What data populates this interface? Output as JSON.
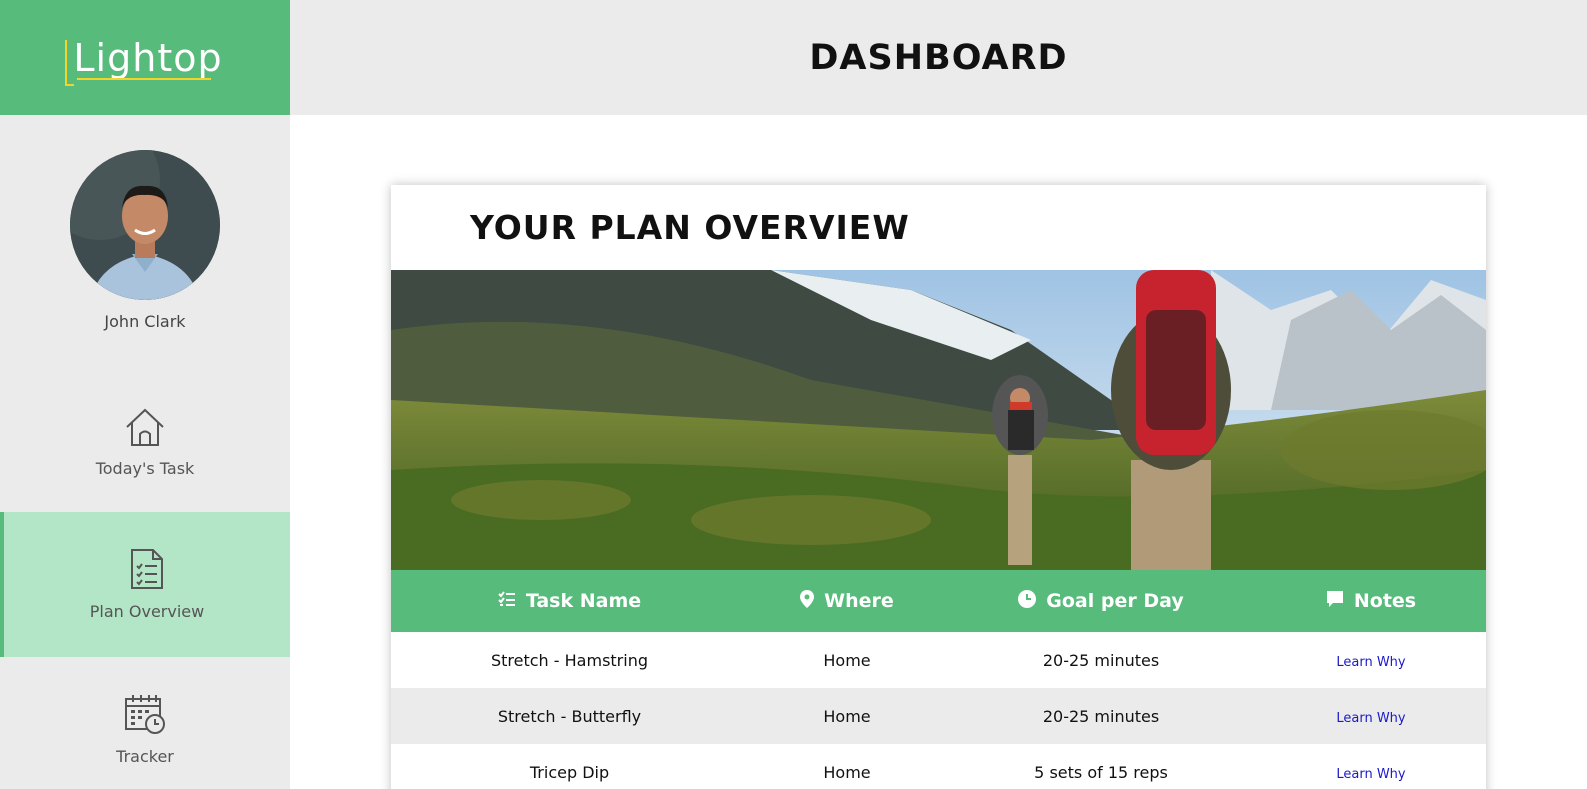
{
  "app": {
    "logo": "Lightop"
  },
  "header": {
    "title": "DASHBOARD"
  },
  "profile": {
    "name": "John Clark"
  },
  "sidebar": {
    "items": [
      {
        "label": "Today's Task",
        "icon": "home-icon",
        "active": false
      },
      {
        "label": "Plan Overview",
        "icon": "checklist-icon",
        "active": true
      },
      {
        "label": "Tracker",
        "icon": "calendar-clock-icon",
        "active": false
      }
    ]
  },
  "main": {
    "card_title": "YOUR PLAN OVERVIEW",
    "table": {
      "headers": [
        {
          "label": "Task Name",
          "icon": "list-check-icon"
        },
        {
          "label": "Where",
          "icon": "map-pin-icon"
        },
        {
          "label": "Goal per Day",
          "icon": "clock-icon"
        },
        {
          "label": "Notes",
          "icon": "comment-icon"
        }
      ],
      "rows": [
        {
          "task": "Stretch - Hamstring",
          "where": "Home",
          "goal": "20-25 minutes",
          "notes": "Learn Why"
        },
        {
          "task": "Stretch - Butterfly",
          "where": "Home",
          "goal": "20-25 minutes",
          "notes": "Learn Why"
        },
        {
          "task": "Tricep Dip",
          "where": "Home",
          "goal": "5 sets of 15 reps",
          "notes": "Learn Why"
        }
      ]
    }
  },
  "colors": {
    "brand_green": "#57bb7b",
    "active_nav": "#b3e6c6",
    "panel_gray": "#ebebeb",
    "logo_accent": "#f3d52a",
    "link_blue": "#1a1acc"
  }
}
